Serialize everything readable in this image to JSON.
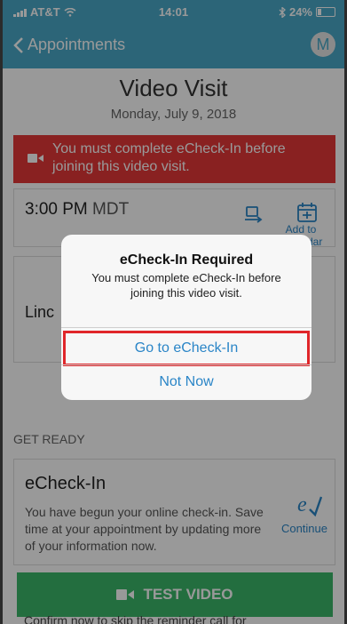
{
  "status_bar": {
    "carrier": "AT&T",
    "time": "14:01",
    "battery": "24%",
    "battery_level": 0.24
  },
  "nav": {
    "back_label": "Appointments",
    "avatar_initial": "M"
  },
  "visit": {
    "title": "Video Visit",
    "date": "Monday, July 9, 2018"
  },
  "alert": {
    "message": "You must complete eCheck-In before joining this video visit."
  },
  "appointment": {
    "time": "3:00 PM",
    "timezone": "MDT",
    "calendar_label": "Add to Calendar"
  },
  "provider": {
    "name_partial": "Linc"
  },
  "get_ready": {
    "label": "GET READY"
  },
  "echeck": {
    "title": "eCheck-In",
    "description": "You have begun your online check-in. Save time at your appointment by updating more of your information now.",
    "continue_label": "Continue"
  },
  "test_video": {
    "label": "TEST VIDEO",
    "reminder_partial": "Confirm now to skip the reminder call for"
  },
  "modal": {
    "title": "eCheck-In Required",
    "message": "You must complete eCheck-In before joining this video visit.",
    "primary_action": "Go to eCheck-In",
    "secondary_action": "Not Now"
  },
  "colors": {
    "header": "#4aa9c8",
    "alert": "#e53838",
    "accent": "#2a85c7",
    "button_green": "#3bb86a",
    "highlight": "#e0262a"
  }
}
